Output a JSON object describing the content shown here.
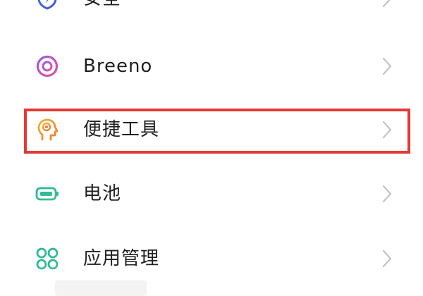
{
  "settings_list": {
    "items": [
      {
        "id": "security",
        "label": "安全",
        "icon": "shield-icon",
        "color": "#3f6fd8"
      },
      {
        "id": "breeno",
        "label": "Breeno",
        "icon": "breeno-ring-icon",
        "color": "#c04fd0"
      },
      {
        "id": "tools",
        "label": "便捷工具",
        "icon": "head-tools-icon",
        "color": "#f29a2e",
        "highlighted": true
      },
      {
        "id": "battery",
        "label": "电池",
        "icon": "battery-icon",
        "color": "#2bb39b"
      },
      {
        "id": "apps",
        "label": "应用管理",
        "icon": "app-grid-icon",
        "color": "#2bb39b"
      }
    ]
  },
  "highlight": {
    "color": "#e53935"
  }
}
